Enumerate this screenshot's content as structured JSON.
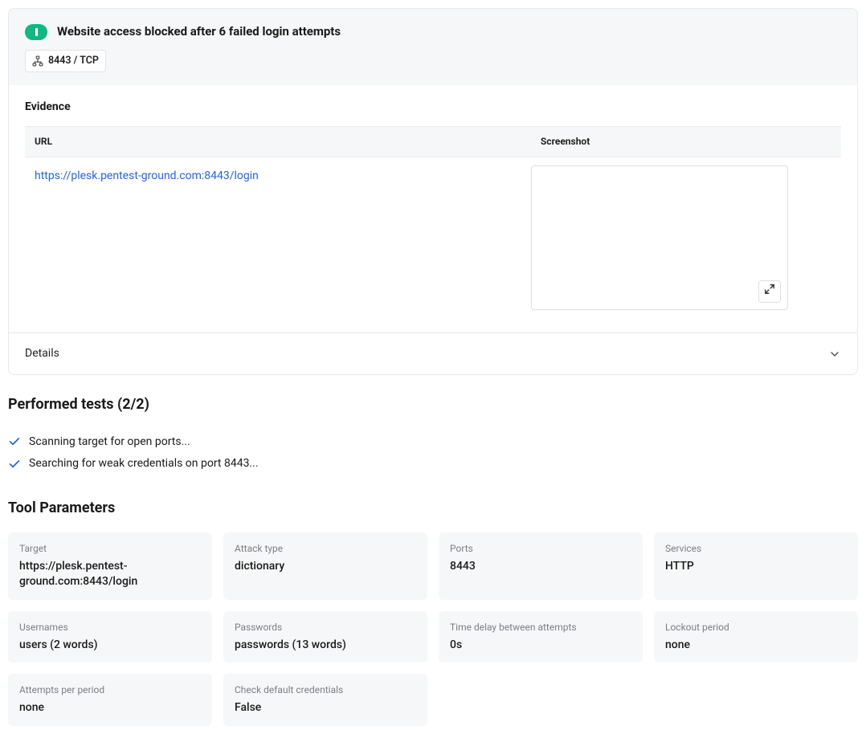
{
  "finding": {
    "title": "Website access blocked after 6 failed login attempts",
    "port_chip": "8443 / TCP"
  },
  "evidence": {
    "heading": "Evidence",
    "columns": {
      "url": "URL",
      "screenshot": "Screenshot"
    },
    "rows": [
      {
        "url": "https://plesk.pentest-ground.com:8443/login"
      }
    ]
  },
  "details": {
    "label": "Details"
  },
  "performed_tests": {
    "heading": "Performed tests (2/2)",
    "items": [
      "Scanning target for open ports...",
      "Searching for weak credentials on port 8443..."
    ]
  },
  "tool_params": {
    "heading": "Tool Parameters",
    "params": [
      {
        "label": "Target",
        "value": "https://plesk.pentest-ground.com:8443/login"
      },
      {
        "label": "Attack type",
        "value": "dictionary"
      },
      {
        "label": "Ports",
        "value": "8443"
      },
      {
        "label": "Services",
        "value": "HTTP"
      },
      {
        "label": "Usernames",
        "value": "users (2 words)"
      },
      {
        "label": "Passwords",
        "value": "passwords (13 words)"
      },
      {
        "label": "Time delay between attempts",
        "value": "0s"
      },
      {
        "label": "Lockout period",
        "value": "none"
      },
      {
        "label": "Attempts per period",
        "value": "none"
      },
      {
        "label": "Check default credentials",
        "value": "False"
      }
    ]
  }
}
